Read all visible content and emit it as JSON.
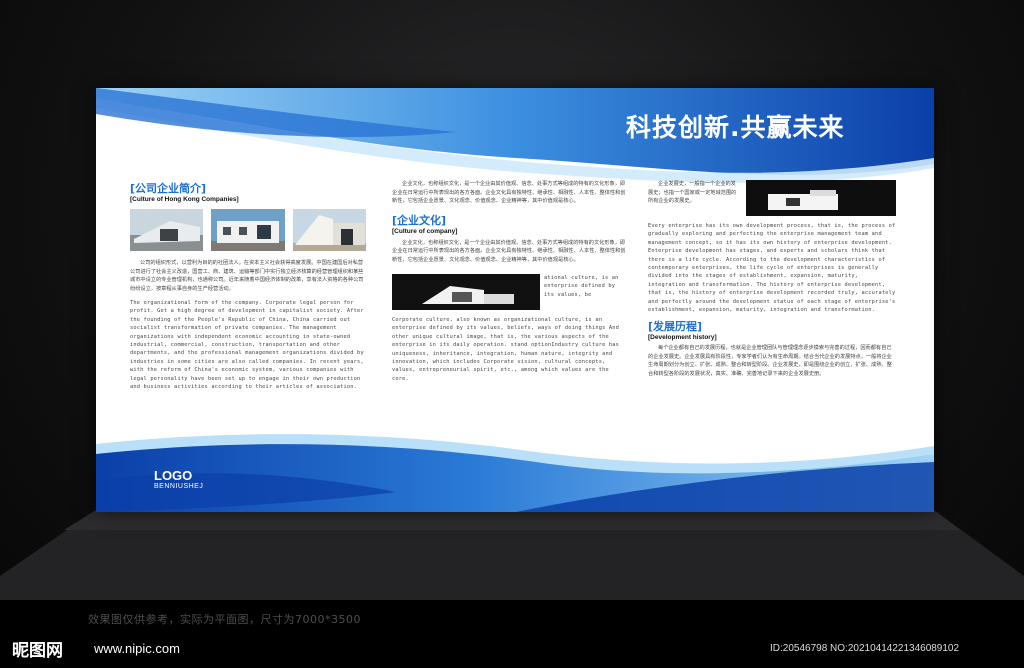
{
  "slogan": "科技创新.共赢未来",
  "logo": {
    "title": "LOGO",
    "subtitle": "BENNIUSHEJ"
  },
  "section1": {
    "heading_cn": "[公司企业简介]",
    "heading_en": "[Culture of Hong Kong Companies]",
    "body_cn": "公司的组织形式，以营利为目的的社团法人。在资本主义社会获得高度发展。中国在建国后对私营公司进行了社会主义改造，国营工、商、建筑、运输等部门中实行独立经济核算的经营管理组织和某些城市中设立的专业管理机构，也通称公司。近年来随着中国经济体制的改革，享有法人资格的各种公司纷纷设立，按章程从事自身的生产经营活动。",
    "body_en": "The organizational form of the company. Corporate legal person for profit. Get a high degree of development in capitalist society. After the founding of the People's Republic of China, China carried out socialist transformation of private companies. The management organizations with independent economic accounting in state-owned industrial, commercial, construction, transportation and other departments, and the professional management organizations divided by industries in some cities are also called companies. In recent years, with the reform of China's economic system, various companies with legal personality have been set up to engage in their own production and business activities according to their articles of association."
  },
  "section2": {
    "intro_cn": "企业文化，也称组织文化，是一个企业由其价值观、信念、处事方式等组成的特有的文化形象，即企业在日常运行中所表现出的各方各面。企业文化具有独特性、继承性、相融性、人本性、整体性和创新性，它包括企业愿景、文化观念、价值观念、企业精神等，其中价值观是核心。",
    "heading_cn": "[企业文化]",
    "heading_en": "[Culture of company]",
    "body_cn": "企业文化，也称组织文化，是一个企业由其价值观、信念、处事方式等组成的特有的文化形象，即企业在日常运行中所表现出的各方各面。企业文化具有独特性、继承性、相融性、人本性、整体性和创新性，它包括企业愿景、文化观念、价值观念、企业精神等，其中价值观是核心。",
    "side_en": "ational culture, is an enterprise defined by its values, be",
    "body_en": "Corporate culture, also known as organizational culture, is an enterprise defined by its values, beliefs, ways of doing things And other unique cultural image, that is, the various aspects of the enterprise in its daily operation. stand optionIndustry culture has uniqueness, inheritance, integration, human nature, integrity and innovation, which includes Corporate vision, cultural concepts, values, entrepreneurial spirit, etc., among which values are the core."
  },
  "section3": {
    "intro_cn": "企业发展史，一般指一个企业的发展史；也指一个国家或一定地域范围的所有企业的发展史。",
    "body_en": "Every enterprise has its own development process, that is, the process of gradually exploring and perfecting the enterprise management team and management concept, so it has its own history of enterprise development. Enterprise development has stages, and experts and scholars think that there is a life cycle. According to the development characteristics of contemporary enterprises, the life cycle of enterprises is generally divided into the stages of establishment, expansion, maturity, integration and transformation. The history of enterprise development, that is, the history of enterprise development recorded truly, accurately and perfectly around the development status of each stage of enterprise's establishment, expansion, maturity, integration and transformation.",
    "heading_cn": "[发展历程]",
    "heading_en": "[Development history]",
    "body_cn": "每个企业都有自己的发展历程，也就是企业管理团队与管理理念逐步摸索与完善的过程，因而都有自己的企业发展史。企业发展具有阶段性，专家学者们认为有生命周期。结合当代企业的发展特点，一般将企业生命周期划分为创立、扩张、成熟、整合和转型阶段。企业发展史，即是围绕企业的创立、扩张、成熟、整合和转型各阶段的发展状况，真实、准确、完善地记录下来的企业发展史册。"
  },
  "caption": "效果图仅供参考，实际为平面图，尺寸为7000*3500",
  "watermark": {
    "brand": "昵图网",
    "url": "www.nipic.com",
    "id_line": "ID:20546798 NO:20210414221346089102"
  },
  "colors": {
    "primary_blue": "#1d6fd0",
    "deep_blue": "#0b3fa8",
    "light_blue": "#5fb4ef"
  }
}
